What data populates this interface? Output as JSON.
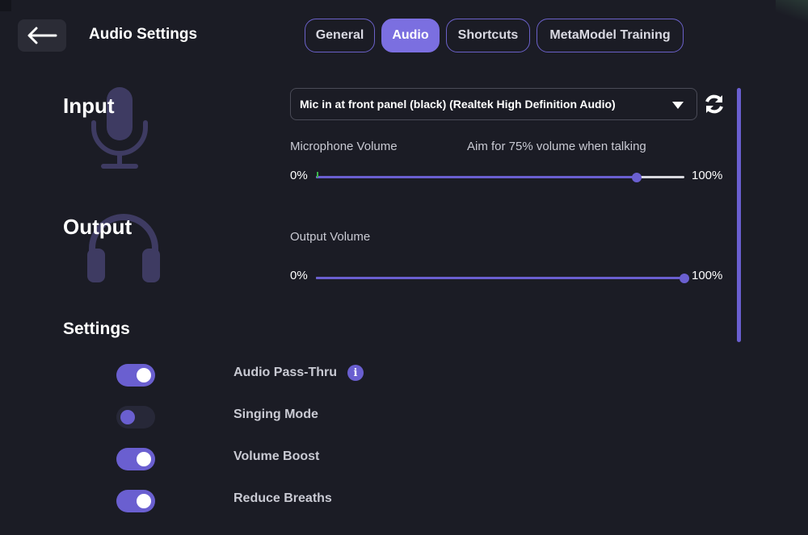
{
  "header": {
    "title": "Audio Settings",
    "back_icon": "arrow-left-icon"
  },
  "tabs": [
    {
      "label": "General",
      "active": false
    },
    {
      "label": "Audio",
      "active": true
    },
    {
      "label": "Shortcuts",
      "active": false
    },
    {
      "label": "MetaModel Training",
      "active": false
    }
  ],
  "input": {
    "title": "Input",
    "icon": "microphone-icon",
    "device": "Mic in at front panel (black) (Realtek High Definition Audio)",
    "volume_label": "Microphone Volume",
    "hint": "Aim for 75% volume when talking",
    "min_label": "0%",
    "max_label": "100%",
    "volume": 0.87
  },
  "output": {
    "title": "Output",
    "icon": "headphones-icon",
    "volume_label": "Output Volume",
    "min_label": "0%",
    "max_label": "100%",
    "volume": 1.0
  },
  "settings": {
    "title": "Settings",
    "items": [
      {
        "label": "Audio Pass-Thru",
        "enabled": true,
        "info": true
      },
      {
        "label": "Singing Mode",
        "enabled": false
      },
      {
        "label": "Volume Boost",
        "enabled": true
      },
      {
        "label": "Reduce Breaths",
        "enabled": true
      }
    ]
  },
  "colors": {
    "background": "#1b1c25",
    "accent": "#6a5fd0",
    "tab_active": "#7b6fe0",
    "icon_dim": "#3e3b62"
  }
}
